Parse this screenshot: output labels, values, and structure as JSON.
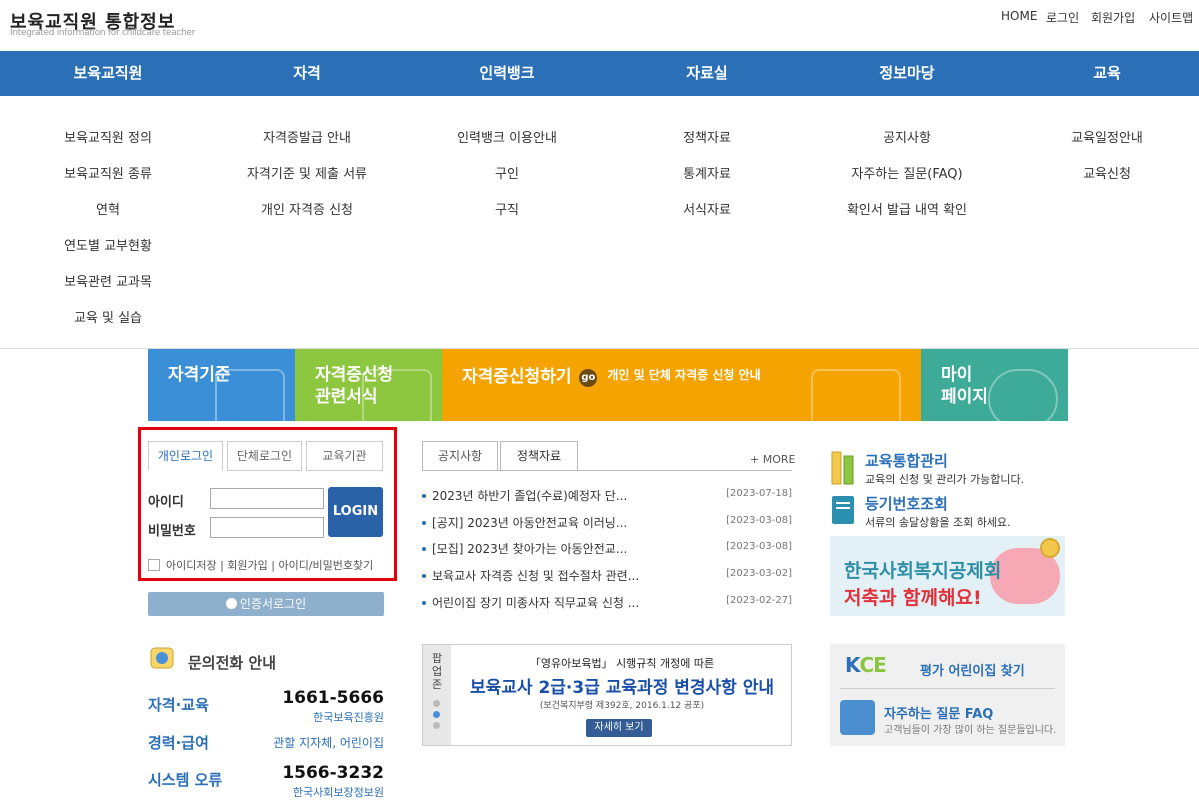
{
  "site": {
    "title": "보육교직원 통합정보",
    "subtitle": "Integrated information for childcare teacher"
  },
  "util_links": [
    "HOME",
    "로그인",
    "회원가입",
    "사이트맵"
  ],
  "gnb": [
    {
      "label": "보육교직원",
      "subs": [
        "보육교직원 정의",
        "보육교직원 종류",
        "연혁",
        "연도별 교부현황",
        "보육관련 교과목",
        "교육 및 실습"
      ]
    },
    {
      "label": "자격",
      "subs": [
        "자격증발급 안내",
        "자격기준 및 제출 서류",
        "개인 자격증 신청"
      ]
    },
    {
      "label": "인력뱅크",
      "subs": [
        "인력뱅크 이용안내",
        "구인",
        "구직"
      ]
    },
    {
      "label": "자료실",
      "subs": [
        "정책자료",
        "통계자료",
        "서식자료"
      ]
    },
    {
      "label": "정보마당",
      "subs": [
        "공지사항",
        "자주하는 질문(FAQ)",
        "확인서 발급 내역 확인"
      ]
    },
    {
      "label": "교육",
      "subs": [
        "교육일정안내",
        "교육신청"
      ]
    }
  ],
  "banners": [
    {
      "line1": "자격기준",
      "line2": ""
    },
    {
      "line1": "자격증신청",
      "line2": "관련서식"
    },
    {
      "line1": "자격증신청하기",
      "go": "go",
      "desc": "개인 및 단체 자격증 신청 안내"
    },
    {
      "line1": "마이",
      "line2": "페이지"
    }
  ],
  "login": {
    "tabs": [
      "개인로그인",
      "단체로그인",
      "교육기관"
    ],
    "id_label": "아이디",
    "pw_label": "비밀번호",
    "button": "LOGIN",
    "links": "아이디저장 | 회원가입 | 아이디/비밀번호찾기",
    "cert_button": "인증서로그인"
  },
  "contact": {
    "title": "문의전화 안내",
    "rows": [
      {
        "category": "자격·교육",
        "number": "1661-5666",
        "org": "한국보육진흥원"
      },
      {
        "category": "경력·급여",
        "number": "",
        "org": "관할 지자체, 어린이집"
      },
      {
        "category": "시스템 오류",
        "number": "1566-3232",
        "org": "한국사회보장정보원"
      }
    ]
  },
  "notice": {
    "tabs": [
      "공지사항",
      "정책자료"
    ],
    "more": "+ MORE",
    "items": [
      {
        "title": "2023년 하반기 졸업(수료)예정자 단...",
        "date": "[2023-07-18]"
      },
      {
        "title": "[공지] 2023년 아동안전교육 이러닝...",
        "date": "[2023-03-08]"
      },
      {
        "title": "[모집] 2023년 찾아가는 아동안전교...",
        "date": "[2023-03-08]"
      },
      {
        "title": "보육교사 자격증 신청 및 접수절차 관련...",
        "date": "[2023-03-02]"
      },
      {
        "title": "어린이집 장기 미종사자 직무교육 신청 ...",
        "date": "[2023-02-27]"
      }
    ]
  },
  "popup": {
    "side_label": "팝업존",
    "sub": "「영유아보육법」 시행규칙 개정에 따른",
    "title": "보육교사 2급·3급 교육과정 변경사항 안내",
    "law": "(보건복지부령 제392호, 2016.1.12 공포)",
    "button": "자세히 보기"
  },
  "right": {
    "edu_title": "교육통합관리",
    "edu_desc": "교육의 신청 및 관리가 가능합니다.",
    "reg_title": "등기번호조회",
    "reg_desc": "서류의 송달상황을 조회 하세요.",
    "ad_line1": "한국사회복지공제회",
    "ad_line2": "저축과 함께해요!",
    "kce_logo_k": "K",
    "kce_logo_rest": "CE",
    "kce_title": "평가 어린이집 찾기",
    "faq_title": "자주하는 질문 FAQ",
    "faq_desc": "고객님들이 가장 많이 하는 질문들입니다."
  },
  "colors": {
    "primary": "#2b6fb6",
    "banner1": "#3a8fd6",
    "banner2": "#8dc63f",
    "banner3": "#f4a300",
    "banner4": "#3eab98",
    "highlight": "#e3000f"
  }
}
